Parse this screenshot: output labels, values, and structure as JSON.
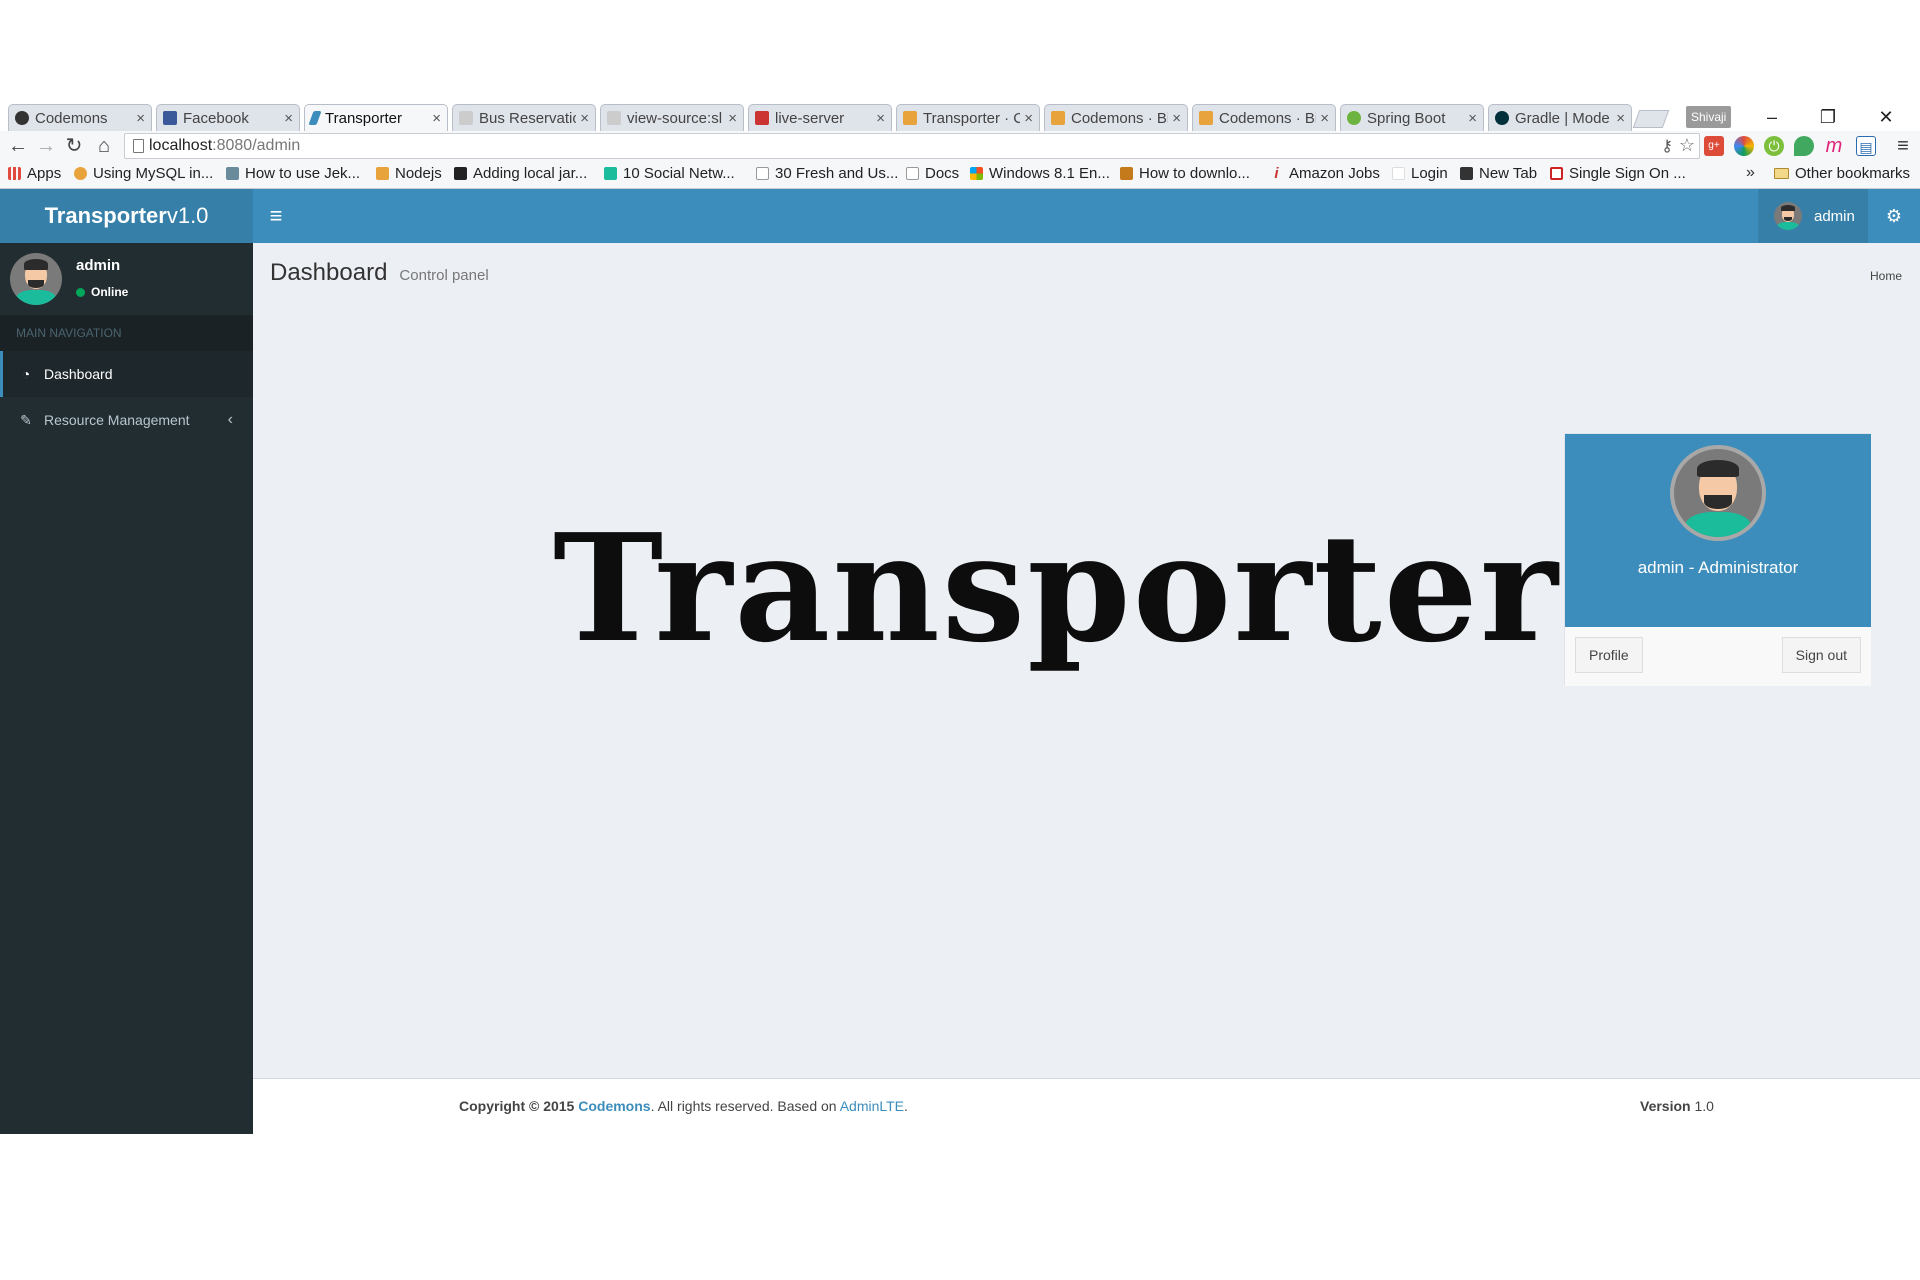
{
  "browser": {
    "tabs": [
      {
        "title": "Codemons",
        "favicon_color": "#333333"
      },
      {
        "title": "Facebook",
        "favicon_color": "#3b5998"
      },
      {
        "title": "Transporter",
        "favicon_color": "#3c8dbc"
      },
      {
        "title": "Bus Reservatio",
        "favicon_color": "#bbbbbb"
      },
      {
        "title": "view-source:sl",
        "favicon_color": "#bbbbbb"
      },
      {
        "title": "live-server",
        "favicon_color": "#cc3333"
      },
      {
        "title": "Transporter · C",
        "favicon_color": "#e8a33d"
      },
      {
        "title": "Codemons · Bi",
        "favicon_color": "#e8a33d"
      },
      {
        "title": "Codemons · Bi",
        "favicon_color": "#e8a33d"
      },
      {
        "title": "Spring Boot",
        "favicon_color": "#6db33f"
      },
      {
        "title": "Gradle | Mode",
        "favicon_color": "#02303a"
      }
    ],
    "profile_name": "Shivaji",
    "url_host": "localhost",
    "url_rest": ":8080/admin",
    "bookmarks": [
      {
        "label": "Apps",
        "color": "#e04a3f"
      },
      {
        "label": "Using MySQL in...",
        "color": "#e8a33d"
      },
      {
        "label": "How to use Jek...",
        "color": "#6a8b9b"
      },
      {
        "label": "Nodejs",
        "color": "#e8a33d"
      },
      {
        "label": "Adding local jar...",
        "color": "#222222"
      },
      {
        "label": "10 Social Netw...",
        "color": "#1abc9c"
      },
      {
        "label": "30 Fresh and Us...",
        "color": "#dddddd"
      },
      {
        "label": "Docs",
        "color": "#dddddd"
      },
      {
        "label": "Windows 8.1 En...",
        "color": "#3a7bd5"
      },
      {
        "label": "How to downlo...",
        "color": "#c47a1a"
      },
      {
        "label": "Amazon Jobs",
        "color": "#cc3333"
      },
      {
        "label": "Login",
        "color": "#f0f0f0"
      },
      {
        "label": "New Tab",
        "color": "#333333"
      },
      {
        "label": "Single Sign On ...",
        "color": "#cc2222"
      },
      {
        "label": "Other bookmarks",
        "color": "#f2d889"
      }
    ],
    "more_bookmarks": "»"
  },
  "app": {
    "logo_bold": "Transporter",
    "logo_light": "v1.0",
    "header_user": "admin",
    "sidebar": {
      "user_name": "admin",
      "user_status": "Online",
      "nav_header": "MAIN NAVIGATION",
      "items": [
        {
          "label": "Dashboard",
          "icon": "dashboard-icon"
        },
        {
          "label": "Resource Management",
          "icon": "edit-icon"
        }
      ]
    },
    "content": {
      "title": "Dashboard",
      "subtitle": "Control panel",
      "breadcrumb": "Home",
      "hero": "Transporter"
    },
    "user_dropdown": {
      "name": "admin - Administrator",
      "profile_button": "Profile",
      "signout_button": "Sign out"
    },
    "footer": {
      "copyright_prefix": "Copyright © 2015",
      "company": "Codemons",
      "rights": ". All rights reserved. Based on",
      "based_on": "AdminLTE",
      "period": ".",
      "version_label": "Version",
      "version": "1.0"
    },
    "colors": {
      "primary": "#3c8dbc",
      "sidebar": "#222d32",
      "content_bg": "#ecf0f5"
    }
  }
}
